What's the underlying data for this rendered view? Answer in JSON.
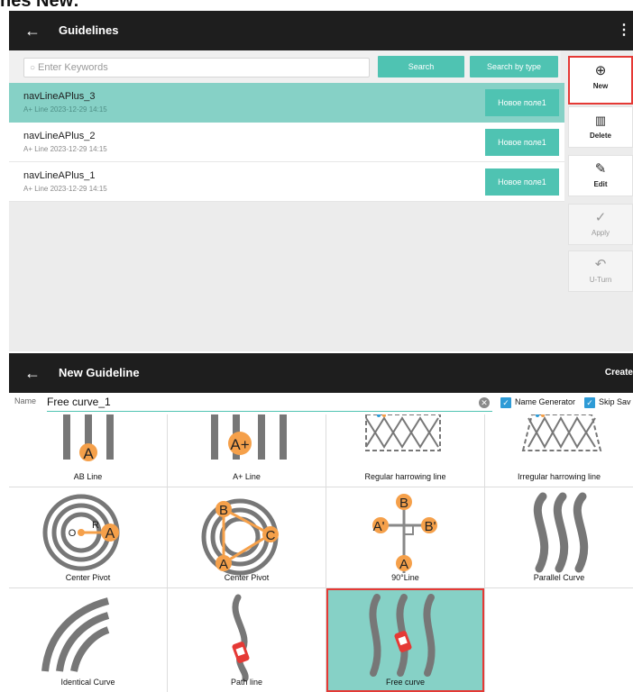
{
  "caption": "nes New:",
  "top": {
    "appbar": {
      "title": "Guidelines",
      "back_icon": "arrow-left-icon",
      "menu_icon": "more-vertical-icon"
    },
    "search": {
      "placeholder": "Enter Keywords",
      "search_label": "Search",
      "search_by_type_label": "Search by type"
    },
    "rows": [
      {
        "name": "navLineAPlus_3",
        "sub": "A+ Line 2023-12-29 14:15",
        "tag": "Новое поле1",
        "selected": true
      },
      {
        "name": "navLineAPlus_2",
        "sub": "A+ Line 2023-12-29 14:15",
        "tag": "Новое поле1",
        "selected": false
      },
      {
        "name": "navLineAPlus_1",
        "sub": "A+ Line 2023-12-29 14:15",
        "tag": "Новое поле1",
        "selected": false
      }
    ],
    "side": [
      {
        "label": "New",
        "icon": "plus-circle-icon",
        "glyph": "⊕"
      },
      {
        "label": "Delete",
        "icon": "trash-icon",
        "glyph": "🗑"
      },
      {
        "label": "Edit",
        "icon": "edit-icon",
        "glyph": "✎"
      },
      {
        "label": "Apply",
        "icon": "check-icon",
        "glyph": "✓"
      },
      {
        "label": "U-Turn",
        "icon": "u-turn-icon",
        "glyph": "↶"
      }
    ]
  },
  "bottom": {
    "appbar": {
      "title": "New Guideline",
      "create_label": "Create",
      "back_icon": "arrow-left-icon"
    },
    "name": {
      "label": "Name",
      "value": "Free curve_1",
      "name_generator": "Name Generator",
      "skip_save": "Skip Sav"
    },
    "tiles": [
      {
        "label": "AB Line",
        "marker": "A"
      },
      {
        "label": "A+ Line",
        "marker": "A+"
      },
      {
        "label": "Regular harrowing line"
      },
      {
        "label": "Irregular harrowing line"
      },
      {
        "label": "Center Pivot",
        "markers": [
          "O",
          "R",
          "A"
        ]
      },
      {
        "label": "Center Pivot",
        "markers": [
          "B",
          "C",
          "A"
        ]
      },
      {
        "label": "90°Line",
        "markers": [
          "B",
          "A'",
          "B'",
          "A"
        ]
      },
      {
        "label": "Parallel Curve"
      },
      {
        "label": "Identical Curve"
      },
      {
        "label": "Path line"
      },
      {
        "label": "Free curve",
        "selected": true
      }
    ]
  },
  "colors": {
    "teal": "#4fc3b2",
    "teal_selected": "#86d1c6",
    "highlight": "#e53935",
    "orange": "#f5a04a",
    "checkbox": "#2e9bd6"
  }
}
